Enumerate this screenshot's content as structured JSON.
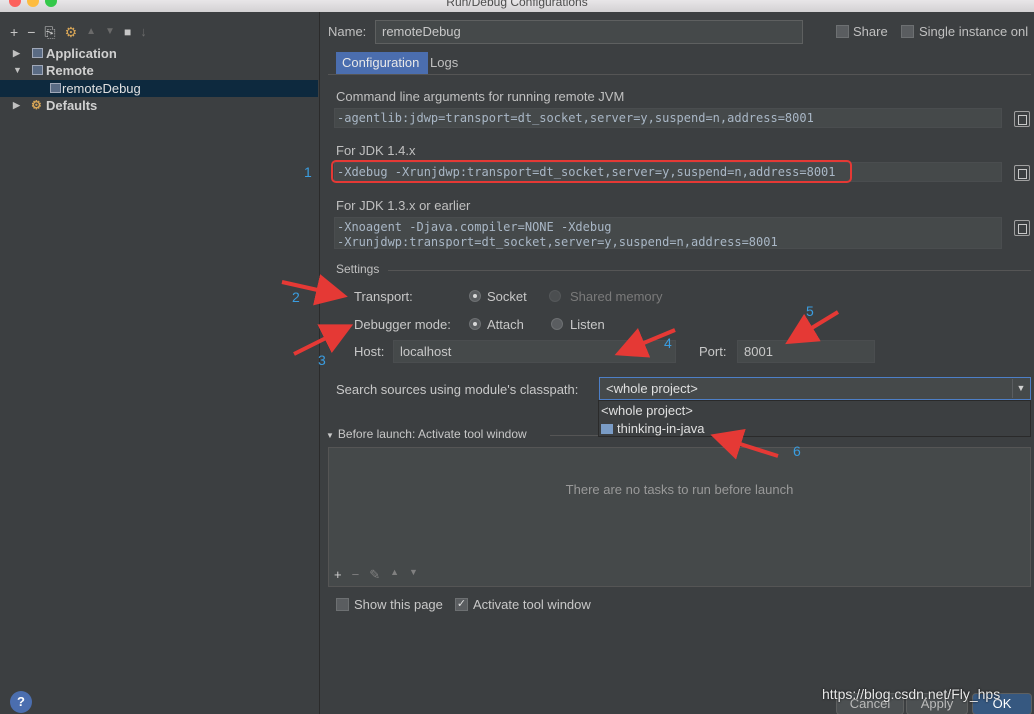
{
  "window": {
    "title": "Run/Debug Configurations"
  },
  "left_panel": {
    "toolbar_icons": [
      "add-icon",
      "remove-icon",
      "copy-icon",
      "wrench-icon",
      "move-up-icon",
      "move-down-icon",
      "folder-icon",
      "sort-icon"
    ],
    "toolbar_glyphs": {
      "add": "+",
      "remove": "−",
      "copy": "⎘",
      "wrench": "⚙",
      "up": "▲",
      "down": "▼",
      "folder": "■",
      "sort": "↓"
    },
    "tree": [
      {
        "label": "Application",
        "expanded": false,
        "icon": "application-config-icon"
      },
      {
        "label": "Remote",
        "expanded": true,
        "icon": "remote-config-icon"
      },
      {
        "label": "remoteDebug",
        "selected": true,
        "icon": "remote-debug-icon"
      },
      {
        "label": "Defaults",
        "expanded": false,
        "icon": "defaults-wrench-icon"
      }
    ]
  },
  "header": {
    "name_label": "Name:",
    "name_value": "remoteDebug",
    "share_label": "Share",
    "single_instance_label": "Single instance onl"
  },
  "tabs": [
    {
      "label": "Configuration",
      "active": true
    },
    {
      "label": "Logs",
      "active": false
    }
  ],
  "jvm_args": {
    "title": "Command line arguments for running remote JVM",
    "value": "-agentlib:jdwp=transport=dt_socket,server=y,suspend=n,address=8001",
    "jdk14_title": "For JDK 1.4.x",
    "jdk14_value": "-Xdebug -Xrunjdwp:transport=dt_socket,server=y,suspend=n,address=8001",
    "jdk13_title": "For JDK 1.3.x or earlier",
    "jdk13_line1": "-Xnoagent -Djava.compiler=NONE -Xdebug",
    "jdk13_line2": "-Xrunjdwp:transport=dt_socket,server=y,suspend=n,address=8001"
  },
  "settings": {
    "title": "Settings",
    "transport_label": "Transport:",
    "transport_options": [
      {
        "label": "Socket",
        "selected": true
      },
      {
        "label": "Shared memory",
        "selected": false,
        "disabled": true
      }
    ],
    "debugger_mode_label": "Debugger mode:",
    "debugger_mode_options": [
      {
        "label": "Attach",
        "selected": true
      },
      {
        "label": "Listen",
        "selected": false
      }
    ],
    "host_label": "Host:",
    "host_value": "localhost",
    "port_label": "Port:",
    "port_value": "8001"
  },
  "classpath": {
    "label": "Search sources using module's classpath:",
    "selected": "<whole project>",
    "options": [
      "<whole project>",
      "thinking-in-java"
    ]
  },
  "before_launch": {
    "title": "Before launch: Activate tool window",
    "empty_text": "There are no tasks to run before launch",
    "toolbar_glyphs": [
      "+",
      "−",
      "✎",
      "▲",
      "▼"
    ],
    "show_page_label": "Show this page",
    "show_page_checked": false,
    "activate_label": "Activate tool window",
    "activate_checked": true
  },
  "footer": {
    "help": "?",
    "cancel_label": "Cancel",
    "apply_label": "Apply",
    "ok_label": "OK"
  },
  "annotations": [
    "1",
    "2",
    "3",
    "4",
    "5",
    "6"
  ],
  "watermark": "https://blog.csdn.net/Fly_hps",
  "colors": {
    "annotation": "#3a9de0",
    "arrow": "#e53935",
    "highlight_box": "#e53935",
    "accent": "#4b6eaf"
  }
}
